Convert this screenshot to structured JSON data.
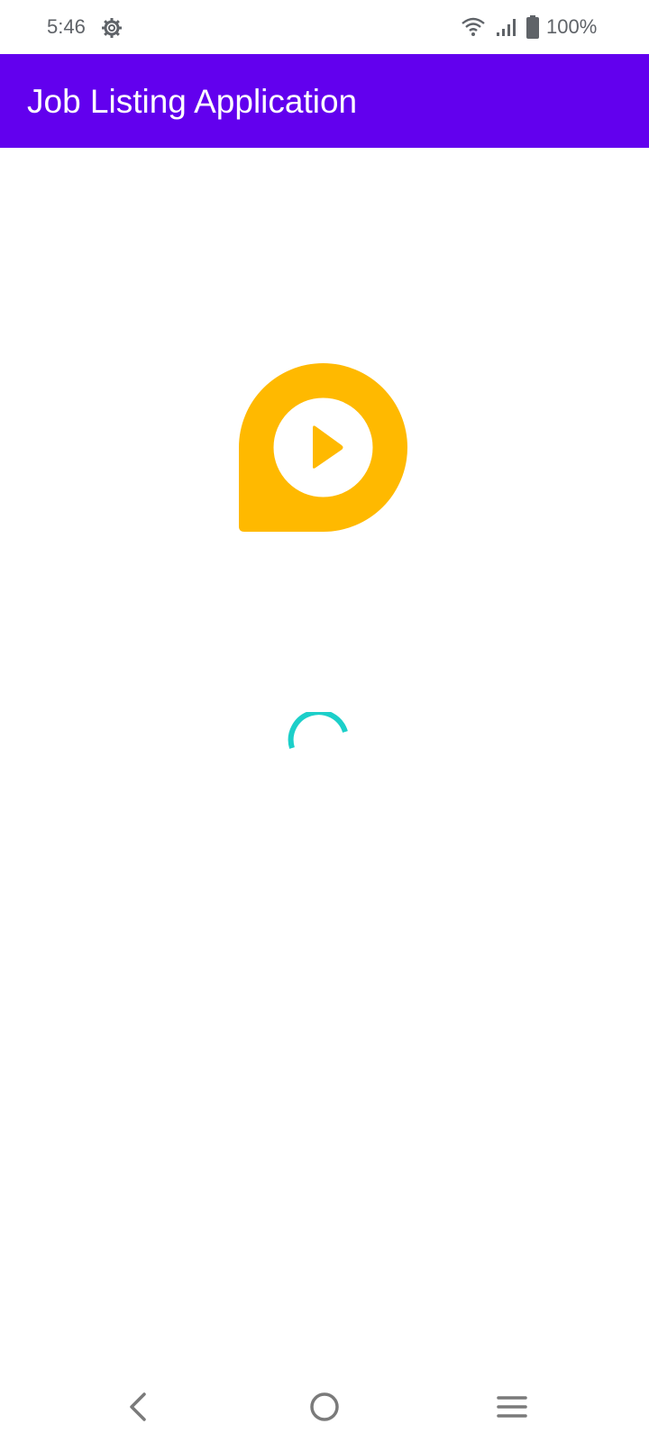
{
  "status_bar": {
    "time": "5:46",
    "battery_percent": "100%",
    "icons": [
      "settings-gear-icon",
      "wifi-icon",
      "cell-signal-icon",
      "battery-icon"
    ]
  },
  "app_bar": {
    "title": "Job Listing Application",
    "background_color": "#6200ee"
  },
  "splash": {
    "logo_icon": "play-pin-logo-icon",
    "logo_color": "#ffb900",
    "spinner_color": "#1ccfc9"
  },
  "nav_bar": {
    "buttons": [
      "back-icon",
      "home-icon",
      "recents-menu-icon"
    ]
  }
}
